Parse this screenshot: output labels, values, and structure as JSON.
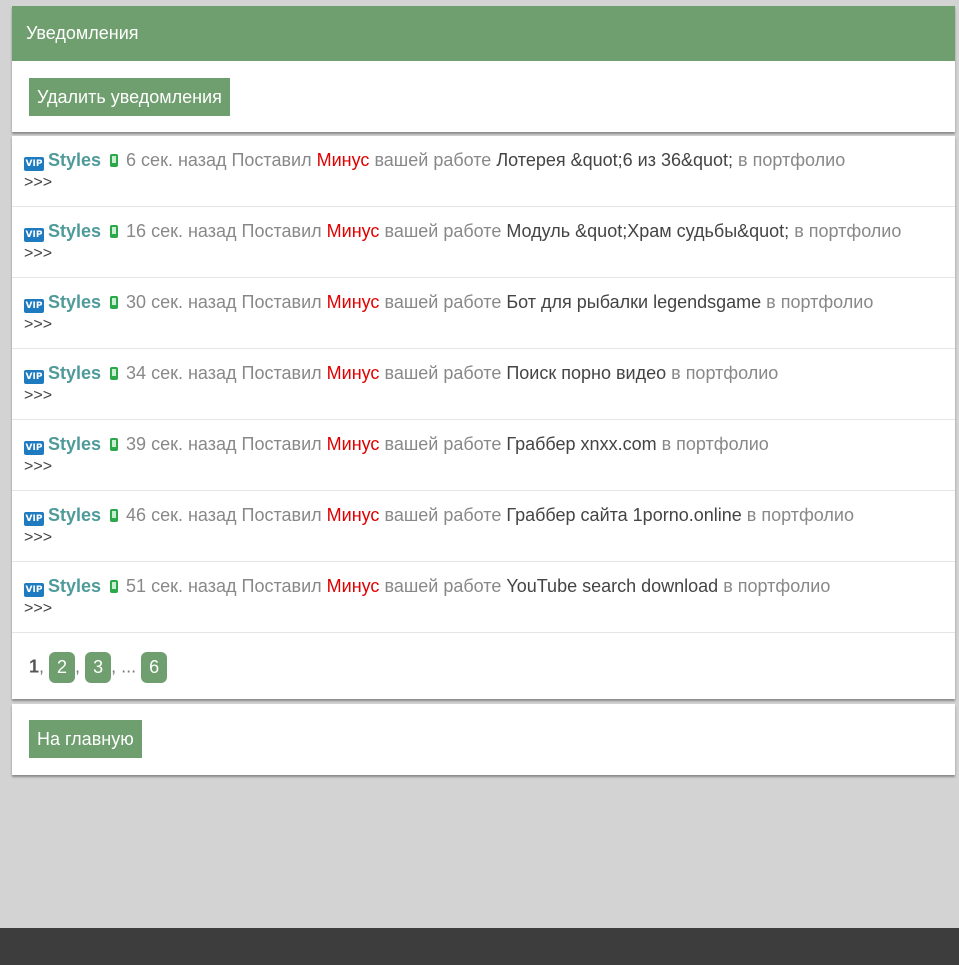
{
  "header": {
    "title": "Уведомления"
  },
  "actions": {
    "delete_label": "Удалить уведомления",
    "home_label": "На главную"
  },
  "notifications": [
    {
      "user": "Styles",
      "time": "6 сек. назад",
      "action": "Поставил",
      "verdict": "Минус",
      "middle": "вашей работе",
      "work": "Лотерея &quot;6 из 36&quot;",
      "suffix": "в портфолио",
      "more": ">>>"
    },
    {
      "user": "Styles",
      "time": "16 сек. назад",
      "action": "Поставил",
      "verdict": "Минус",
      "middle": "вашей работе",
      "work": "Модуль &quot;Храм судьбы&quot;",
      "suffix": "в портфолио",
      "more": ">>>"
    },
    {
      "user": "Styles",
      "time": "30 сек. назад",
      "action": "Поставил",
      "verdict": "Минус",
      "middle": "вашей работе",
      "work": "Бот для рыбалки legendsgame",
      "suffix": "в портфолио",
      "more": ">>>"
    },
    {
      "user": "Styles",
      "time": "34 сек. назад",
      "action": "Поставил",
      "verdict": "Минус",
      "middle": "вашей работе",
      "work": "Поиск порно видео",
      "suffix": "в портфолио",
      "more": ">>>"
    },
    {
      "user": "Styles",
      "time": "39 сек. назад",
      "action": "Поставил",
      "verdict": "Минус",
      "middle": "вашей работе",
      "work": "Граббер xnxx.com",
      "suffix": "в портфолио",
      "more": ">>>"
    },
    {
      "user": "Styles",
      "time": "46 сек. назад",
      "action": "Поставил",
      "verdict": "Минус",
      "middle": "вашей работе",
      "work": "Граббер сайта 1porno.online",
      "suffix": "в портфолио",
      "more": ">>>"
    },
    {
      "user": "Styles",
      "time": "51 сек. назад",
      "action": "Поставил",
      "verdict": "Минус",
      "middle": "вашей работе",
      "work": "YouTube search download",
      "suffix": "в портфолио",
      "more": ">>>"
    }
  ],
  "pagination": {
    "current": "1",
    "pages": [
      "2",
      "3"
    ],
    "ellipsis": "...",
    "last": "6",
    "sep": ","
  },
  "colors": {
    "accent": "#6f9e6f",
    "minus": "#e00000",
    "user": "#4f9a9a",
    "vip": "#1f7bc0"
  },
  "icons": {
    "vip": "vip-badge-icon",
    "device": "mobile-phone-icon"
  },
  "badges": {
    "vip": "VIP"
  }
}
